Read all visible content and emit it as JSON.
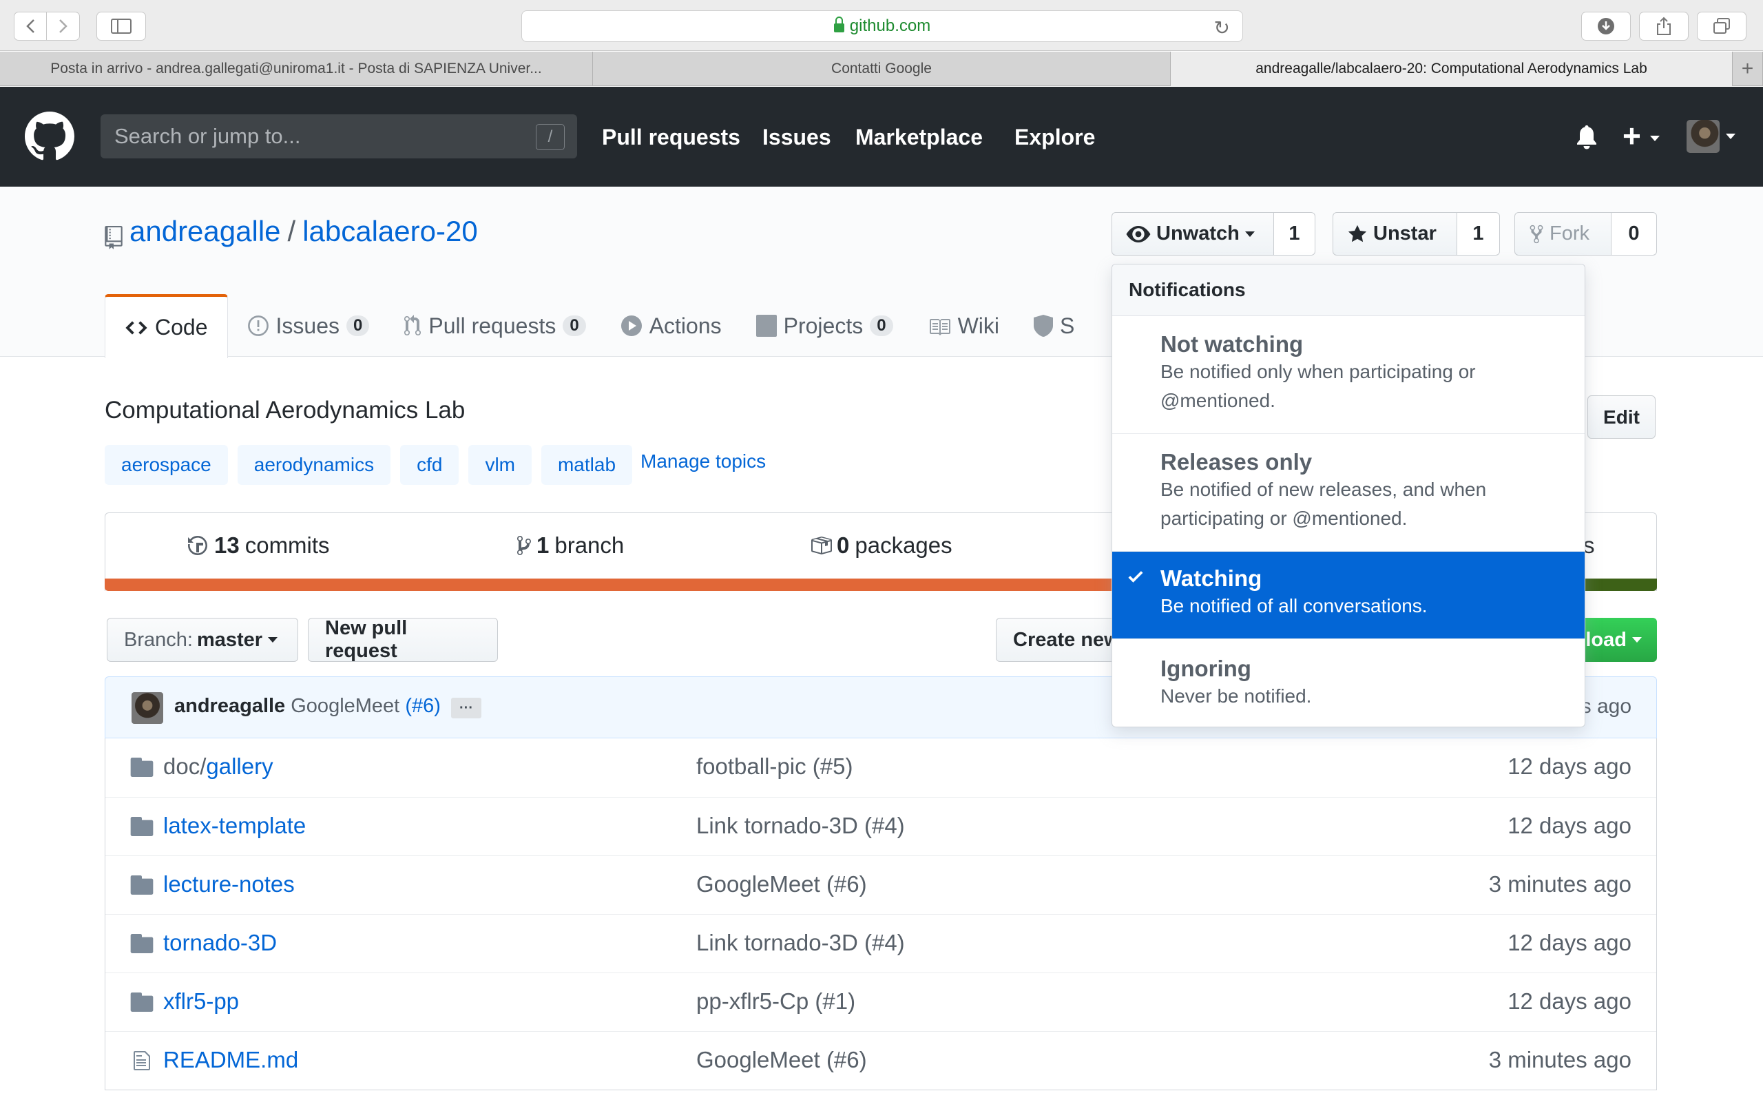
{
  "browser": {
    "url": "github.com",
    "tabs": [
      {
        "label": "Posta in arrivo - andrea.gallegati@uniroma1.it - Posta di SAPIENZA Univer...",
        "active": false
      },
      {
        "label": "Contatti Google",
        "active": false
      },
      {
        "label": "andreagalle/labcalaero-20: Computational Aerodynamics Lab",
        "active": true
      }
    ],
    "new_tab": "+"
  },
  "header": {
    "search_placeholder": "Search or jump to...",
    "search_shortcut": "/",
    "nav": [
      "Pull requests",
      "Issues",
      "Marketplace",
      "Explore"
    ],
    "plus": "+"
  },
  "repo": {
    "owner": "andreagalle",
    "separator": "/",
    "name": "labcalaero-20",
    "watch_label": "Unwatch",
    "watch_count": "1",
    "star_label": "Unstar",
    "star_count": "1",
    "fork_label": "Fork",
    "fork_count": "0"
  },
  "tabs": {
    "code": "Code",
    "issues": "Issues",
    "issues_count": "0",
    "pulls": "Pull requests",
    "pulls_count": "0",
    "actions": "Actions",
    "projects": "Projects",
    "projects_count": "0",
    "wiki": "Wiki",
    "security_partial": "S"
  },
  "about": {
    "description": "Computational Aerodynamics Lab",
    "topics": [
      "aerospace",
      "aerodynamics",
      "cfd",
      "vlm",
      "matlab"
    ],
    "manage_topics": "Manage topics",
    "edit": "Edit"
  },
  "stats": {
    "commits_num": "13",
    "commits_label": "commits",
    "branch_num": "1",
    "branch_label": "branch",
    "packages_num": "0",
    "packages_label": "packages",
    "partial_s": "s"
  },
  "languages": [
    {
      "color": "#e16737",
      "fraction": 0.9
    },
    {
      "color": "#3d6117",
      "fraction": 0.1
    }
  ],
  "toolbar": {
    "branch_label": "Branch:",
    "branch_name": "master",
    "new_pr": "New pull request",
    "create_new_partial": "Create new",
    "download_partial": "load"
  },
  "latest_commit": {
    "author": "andreagalle",
    "message": "GoogleMeet",
    "pr": "(#6)",
    "ellipsis": "···",
    "age_partial": "s ago"
  },
  "files": [
    {
      "type": "dir",
      "name_prefix": "doc/",
      "name": "gallery",
      "message": "football-pic (#5)",
      "age": "12 days ago"
    },
    {
      "type": "dir",
      "name_prefix": "",
      "name": "latex-template",
      "message": "Link tornado-3D (#4)",
      "age": "12 days ago"
    },
    {
      "type": "dir",
      "name_prefix": "",
      "name": "lecture-notes",
      "message": "GoogleMeet (#6)",
      "age": "3 minutes ago"
    },
    {
      "type": "dir",
      "name_prefix": "",
      "name": "tornado-3D",
      "message": "Link tornado-3D (#4)",
      "age": "12 days ago"
    },
    {
      "type": "dir",
      "name_prefix": "",
      "name": "xflr5-pp",
      "message": "pp-xflr5-Cp (#1)",
      "age": "12 days ago"
    },
    {
      "type": "file",
      "name_prefix": "",
      "name": "README.md",
      "message": "GoogleMeet (#6)",
      "age": "3 minutes ago"
    }
  ],
  "notifications": {
    "heading": "Notifications",
    "options": [
      {
        "title": "Not watching",
        "desc_lines": [
          "Be notified only when participating or",
          "@mentioned."
        ],
        "selected": false
      },
      {
        "title": "Releases only",
        "desc_lines": [
          "Be notified of new releases, and when",
          "participating or @mentioned."
        ],
        "selected": false
      },
      {
        "title": "Watching",
        "desc_lines": [
          "Be notified of all conversations."
        ],
        "selected": true
      },
      {
        "title": "Ignoring",
        "desc_lines": [
          "Never be notified."
        ],
        "selected": false
      }
    ]
  },
  "colors": {
    "header_bg": "#24292e",
    "link": "#0366d6",
    "selected_tab_accent": "#e36209",
    "dropdown_selected": "#0366d6",
    "clone_green": "#28a745"
  }
}
